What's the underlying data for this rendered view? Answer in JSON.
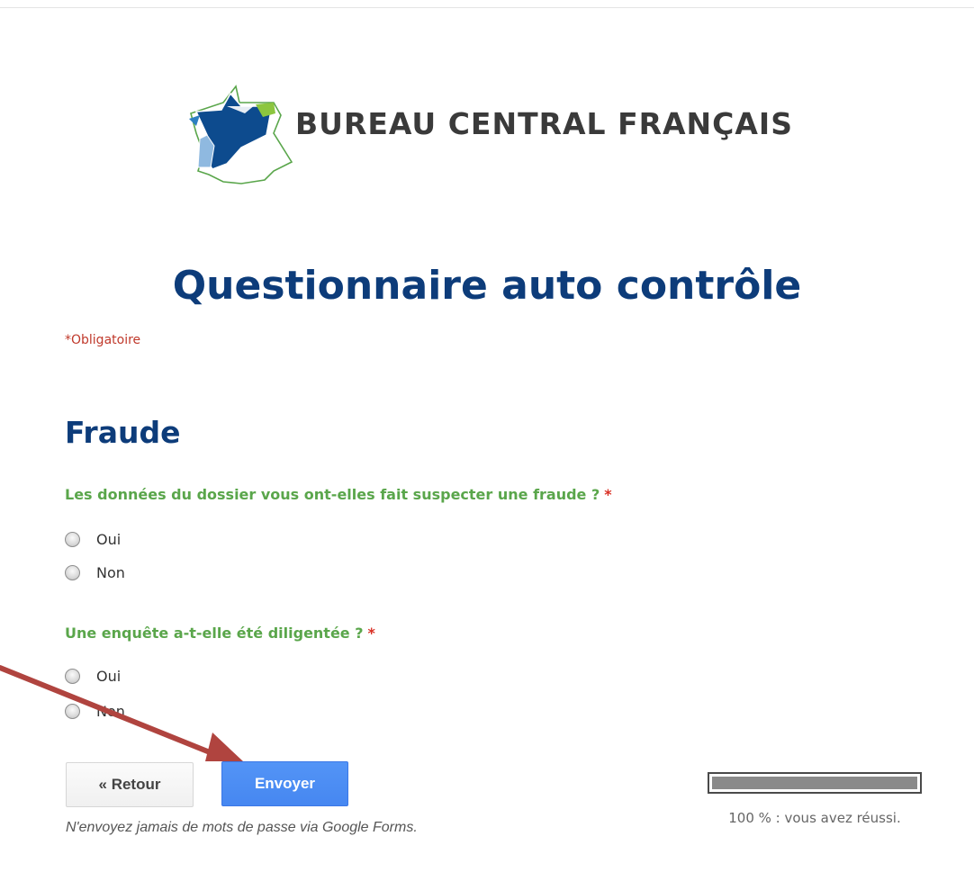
{
  "header": {
    "logo_text": "BUREAU CENTRAL FRANÇAIS"
  },
  "form": {
    "title": "Questionnaire auto contrôle",
    "required_note": "*Obligatoire",
    "section_title": "Fraude",
    "questions": [
      {
        "label": "Les données du dossier vous ont-elles fait suspecter une fraude ?",
        "required_marker": "*",
        "options": [
          "Oui",
          "Non"
        ]
      },
      {
        "label": "Une enquête a-t-elle été diligentée ?",
        "required_marker": "*",
        "options": [
          "Oui",
          "Non"
        ]
      }
    ]
  },
  "footer": {
    "back_label": "« Retour",
    "submit_label": "Envoyer",
    "privacy_note": "N'envoyez jamais de mots de passe via Google Forms.",
    "progress_percent": 100,
    "progress_text": "100 % : vous avez réussi."
  },
  "colors": {
    "title": "#0d3c7a",
    "question": "#5aa64b",
    "required": "#d93025",
    "submit": "#4d8ff4",
    "annotation_arrow": "#b0443f"
  }
}
